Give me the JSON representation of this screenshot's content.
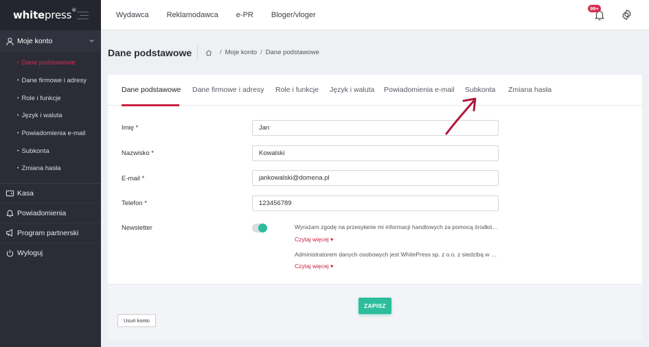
{
  "brand": {
    "name_bold": "white",
    "name_light": "press",
    "trademark": "®"
  },
  "topnav": [
    "Wydawca",
    "Reklamodawca",
    "e-PR",
    "Bloger/vloger"
  ],
  "notifications": {
    "badge": "99+"
  },
  "sidebar": {
    "account_label": "Moje konto",
    "sub_items": [
      {
        "label": "Dane podstawowe",
        "active": true
      },
      {
        "label": "Dane firmowe i adresy"
      },
      {
        "label": "Role i funkcje"
      },
      {
        "label": "Język i waluta"
      },
      {
        "label": "Powiadomienia e-mail"
      },
      {
        "label": "Subkonta"
      },
      {
        "label": "Zmiana hasła"
      }
    ],
    "items": [
      {
        "label": "Kasa",
        "icon": "wallet-icon"
      },
      {
        "label": "Powiadomienia",
        "icon": "bell-icon"
      },
      {
        "label": "Program partnerski",
        "icon": "megaphone-icon"
      },
      {
        "label": "Wyloguj",
        "icon": "power-icon"
      }
    ]
  },
  "page": {
    "title": "Dane podstawowe",
    "breadcrumb": [
      "Moje konto",
      "Dane podstawowe"
    ]
  },
  "tabs": [
    "Dane podstawowe",
    "Dane firmowe i adresy",
    "Role i funkcje",
    "Język i waluta",
    "Powiadomienia e-mail",
    "Subkonta",
    "Zmiana hasła"
  ],
  "form": {
    "first_name": {
      "label": "Imię *",
      "value": "Jan"
    },
    "last_name": {
      "label": "Nazwisko *",
      "value": "Kowalski"
    },
    "email": {
      "label": "E-mail *",
      "value": "jankowalski@domena.pl"
    },
    "phone": {
      "label": "Telefon *",
      "value": "123456789"
    },
    "newsletter": {
      "label": "Newsletter",
      "enabled": true,
      "consent_1": "Wyrażam zgodę na przesyłanie mi informacji handlowych za pomocą środków komunikacji elektronicznej",
      "consent_2": "Administratorem danych osobowych jest WhitePress sp. z o.o. z siedzibą w Bielsku-Białej",
      "read_more": "Czytaj więcej"
    }
  },
  "buttons": {
    "save": "ZAPISZ",
    "delete_account": "Usuń konto"
  },
  "colors": {
    "accent": "#c8203f",
    "primary": "#2dbd9c",
    "sidebar": "#2a2d36"
  }
}
